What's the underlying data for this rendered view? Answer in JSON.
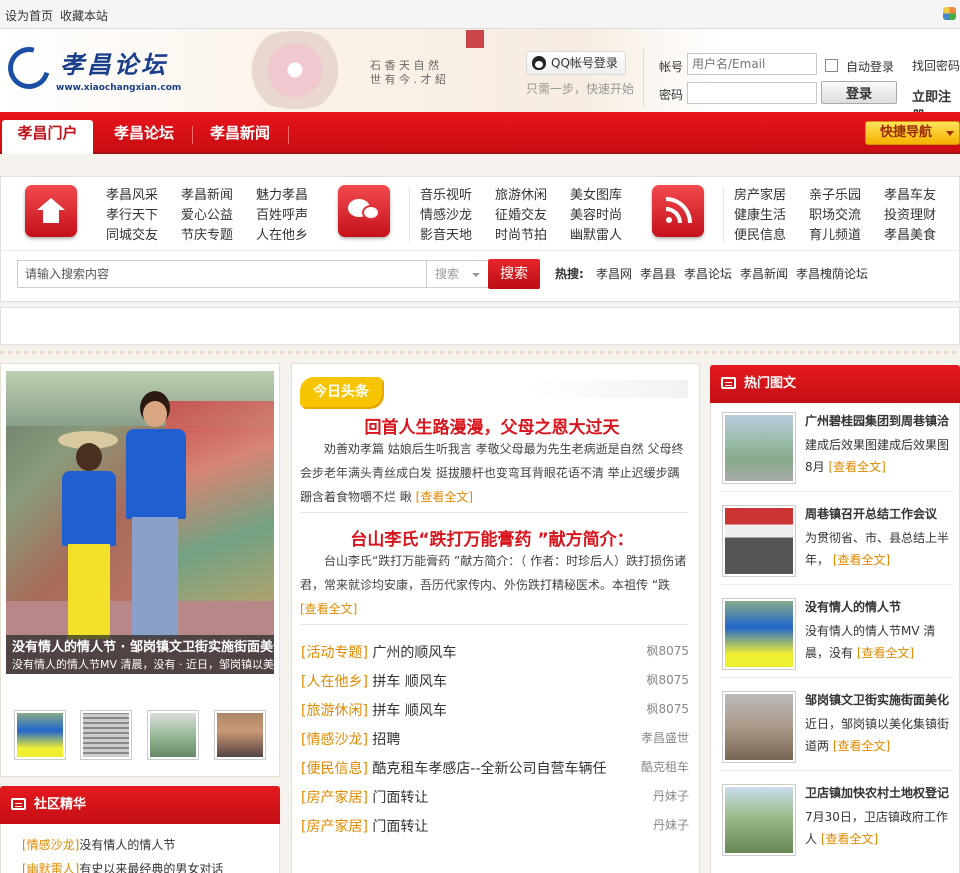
{
  "topbar": {
    "set_home": "设为首页",
    "bookmark": "收藏本站"
  },
  "header": {
    "logo_text": "孝昌论坛",
    "logo_url": "www.xiaochangxian.com",
    "calligraphy_1": "石 香 天 自 然",
    "calligraphy_2": "世 有 今 . 才 紹",
    "qq_login": "QQ帐号登录",
    "qq_sub": "只需一步，快速开始",
    "account_label": "帐号",
    "account_placeholder": "用户名/Email",
    "password_label": "密码",
    "auto_login": "自动登录",
    "find_password": "找回密码",
    "login_button": "登录",
    "register": "立即注册"
  },
  "nav": {
    "tabs": [
      {
        "label": "孝昌门户"
      },
      {
        "label": "孝昌论坛"
      },
      {
        "label": "孝昌新闻"
      }
    ],
    "quick_nav": "快捷导航"
  },
  "categories": {
    "group1": [
      [
        "孝昌风采",
        "孝昌新闻",
        "魅力孝昌"
      ],
      [
        "孝行天下",
        "爱心公益",
        "百姓呼声"
      ],
      [
        "同城交友",
        "节庆专题",
        "人在他乡"
      ]
    ],
    "group2": [
      [
        "音乐视听",
        "旅游休闲",
        "美女图库"
      ],
      [
        "情感沙龙",
        "征婚交友",
        "美容时尚"
      ],
      [
        "影音天地",
        "时尚节拍",
        "幽默雷人"
      ]
    ],
    "group3": [
      [
        "房产家居",
        "亲子乐园",
        "孝昌车友"
      ],
      [
        "健康生活",
        "职场交流",
        "投资理财"
      ],
      [
        "便民信息",
        "育儿频道",
        "孝昌美食"
      ]
    ]
  },
  "search": {
    "placeholder": "请输入搜索内容",
    "type": "搜索",
    "button": "搜索",
    "hot_label": "热搜:",
    "hot": [
      "孝昌网",
      "孝昌县",
      "孝昌论坛",
      "孝昌新闻",
      "孝昌槐荫论坛"
    ]
  },
  "slideshow": {
    "caption_1": "没有情人的情人节 · 邹岗镇文卫街实施街面美化工作事",
    "caption_2": "没有情人的情人节MV 清晨，没有 · 近日，邹岗镇以美化集镇街道两侧环境"
  },
  "community": {
    "title": "社区精华",
    "items": [
      {
        "tag": "[情感沙龙]",
        "text": "没有情人的情人节"
      },
      {
        "tag": "[幽默雷人]",
        "text": "有史以来最经典的男女对话"
      }
    ]
  },
  "headlines": {
    "tag": "今日头条",
    "article_1": {
      "title": "回首人生路漫漫，父母之恩大过天",
      "text": "劝善劝孝篇 姑娘后生听我言 孝敬父母最为先生老病逝是自然 父母终会步老年满头青丝成白发 挺拔腰杆也变弯耳背眼花语不清 举止迟缓步蹒跚含着食物嚼不烂 瞅",
      "more": "[查看全文]"
    },
    "article_2": {
      "title": "台山李氏“跌打万能膏药 ”献方简介：",
      "text": "台山李氏“跌打万能膏药 ”献方简介：（ 作者：时珍后人）跌打损伤诸君，常来就诊均安康，吾历代家传内、外伤跌打精秘医术。本祖传 “跌",
      "more": "[查看全文]"
    },
    "list": [
      {
        "tag": "[活动专题]",
        "title": "广州的顺风车",
        "author": "枫8075"
      },
      {
        "tag": "[人在他乡]",
        "title": "拼车 顺风车",
        "author": "枫8075"
      },
      {
        "tag": "[旅游休闲]",
        "title": "拼车 顺风车",
        "author": "枫8075"
      },
      {
        "tag": "[情感沙龙]",
        "title": "招聘",
        "author": "孝昌盛世"
      },
      {
        "tag": "[便民信息]",
        "title": "酷克租车孝感店--全新公司自营车辆任",
        "author": "酷克租车"
      },
      {
        "tag": "[房产家居]",
        "title": "门面转让",
        "author": "丹妹子"
      },
      {
        "tag": "[房产家居]",
        "title": "门面转让",
        "author": "丹妹子"
      }
    ]
  },
  "hot_pics": {
    "title": "热门图文",
    "items": [
      {
        "title": "广州碧桂园集团到周巷镇洽",
        "desc": "建成后效果图建成后效果图 8月",
        "more": "[查看全文]"
      },
      {
        "title": "周巷镇召开总结工作会议",
        "desc": "为贯彻省、市、县总结上半年，",
        "more": "[查看全文]"
      },
      {
        "title": "没有情人的情人节",
        "desc": "没有情人的情人节MV 清晨，没有",
        "more": "[查看全文]"
      },
      {
        "title": "邹岗镇文卫街实施街面美化",
        "desc": "近日，邹岗镇以美化集镇街道两",
        "more": "[查看全文]"
      },
      {
        "title": "卫店镇加快农村土地权登记",
        "desc": "7月30日，卫店镇政府工作人",
        "more": "[查看全文]"
      }
    ]
  },
  "colors": {
    "brand_red": "#d9141c",
    "tag_orange": "#e08a00",
    "logo_blue": "#1a3f8a"
  }
}
